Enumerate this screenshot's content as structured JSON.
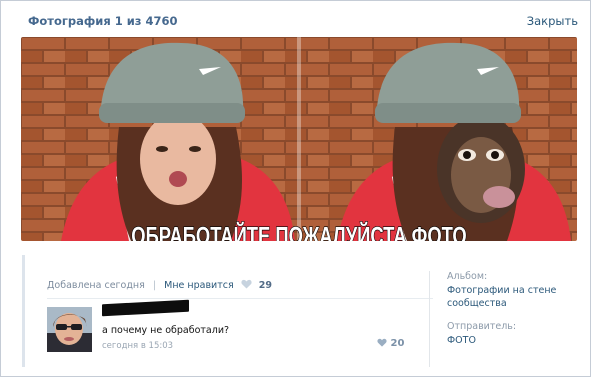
{
  "header": {
    "title": "Фотография 1 из 4760",
    "close_label": "Закрыть"
  },
  "photo": {
    "caption": "ОБРАБОТАЙТЕ ПОЖАЛУЙСТА ФОТО"
  },
  "meta": {
    "added_label": "Добавлена сегодня",
    "separator": "|",
    "like_label": "Мне нравится",
    "like_count": "29"
  },
  "comment": {
    "text": "а почему не обработали?",
    "date": "сегодня в 15:03",
    "likes": "20"
  },
  "sidebar": {
    "album_label": "Альбом:",
    "album_line1": "Фотографии на стене",
    "album_line2": "сообщества",
    "sender_label": "Отправитель:",
    "sender_value": "ФОТО"
  },
  "colors": {
    "link": "#2b587a",
    "title": "#45688e",
    "muted": "#7d8c9e",
    "border": "#c5ccd6"
  }
}
